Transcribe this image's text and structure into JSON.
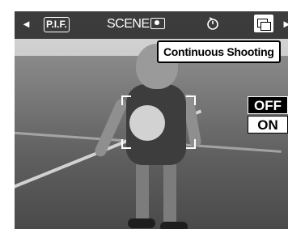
{
  "menu_bar": {
    "left_arrow": "◄",
    "right_arrow": "►",
    "pif_label": "P.I.F.",
    "scene_label": "SCENE",
    "camera_icon": "camera-icon",
    "timer_icon": "self-timer-icon",
    "continuous_icon": "continuous-shooting-icon"
  },
  "tooltip": {
    "text": "Continuous Shooting"
  },
  "options": {
    "off": "OFF",
    "on": "ON",
    "selected": "OFF"
  },
  "colors": {
    "bar_bg": "#000000",
    "highlight": "#ffffff"
  }
}
